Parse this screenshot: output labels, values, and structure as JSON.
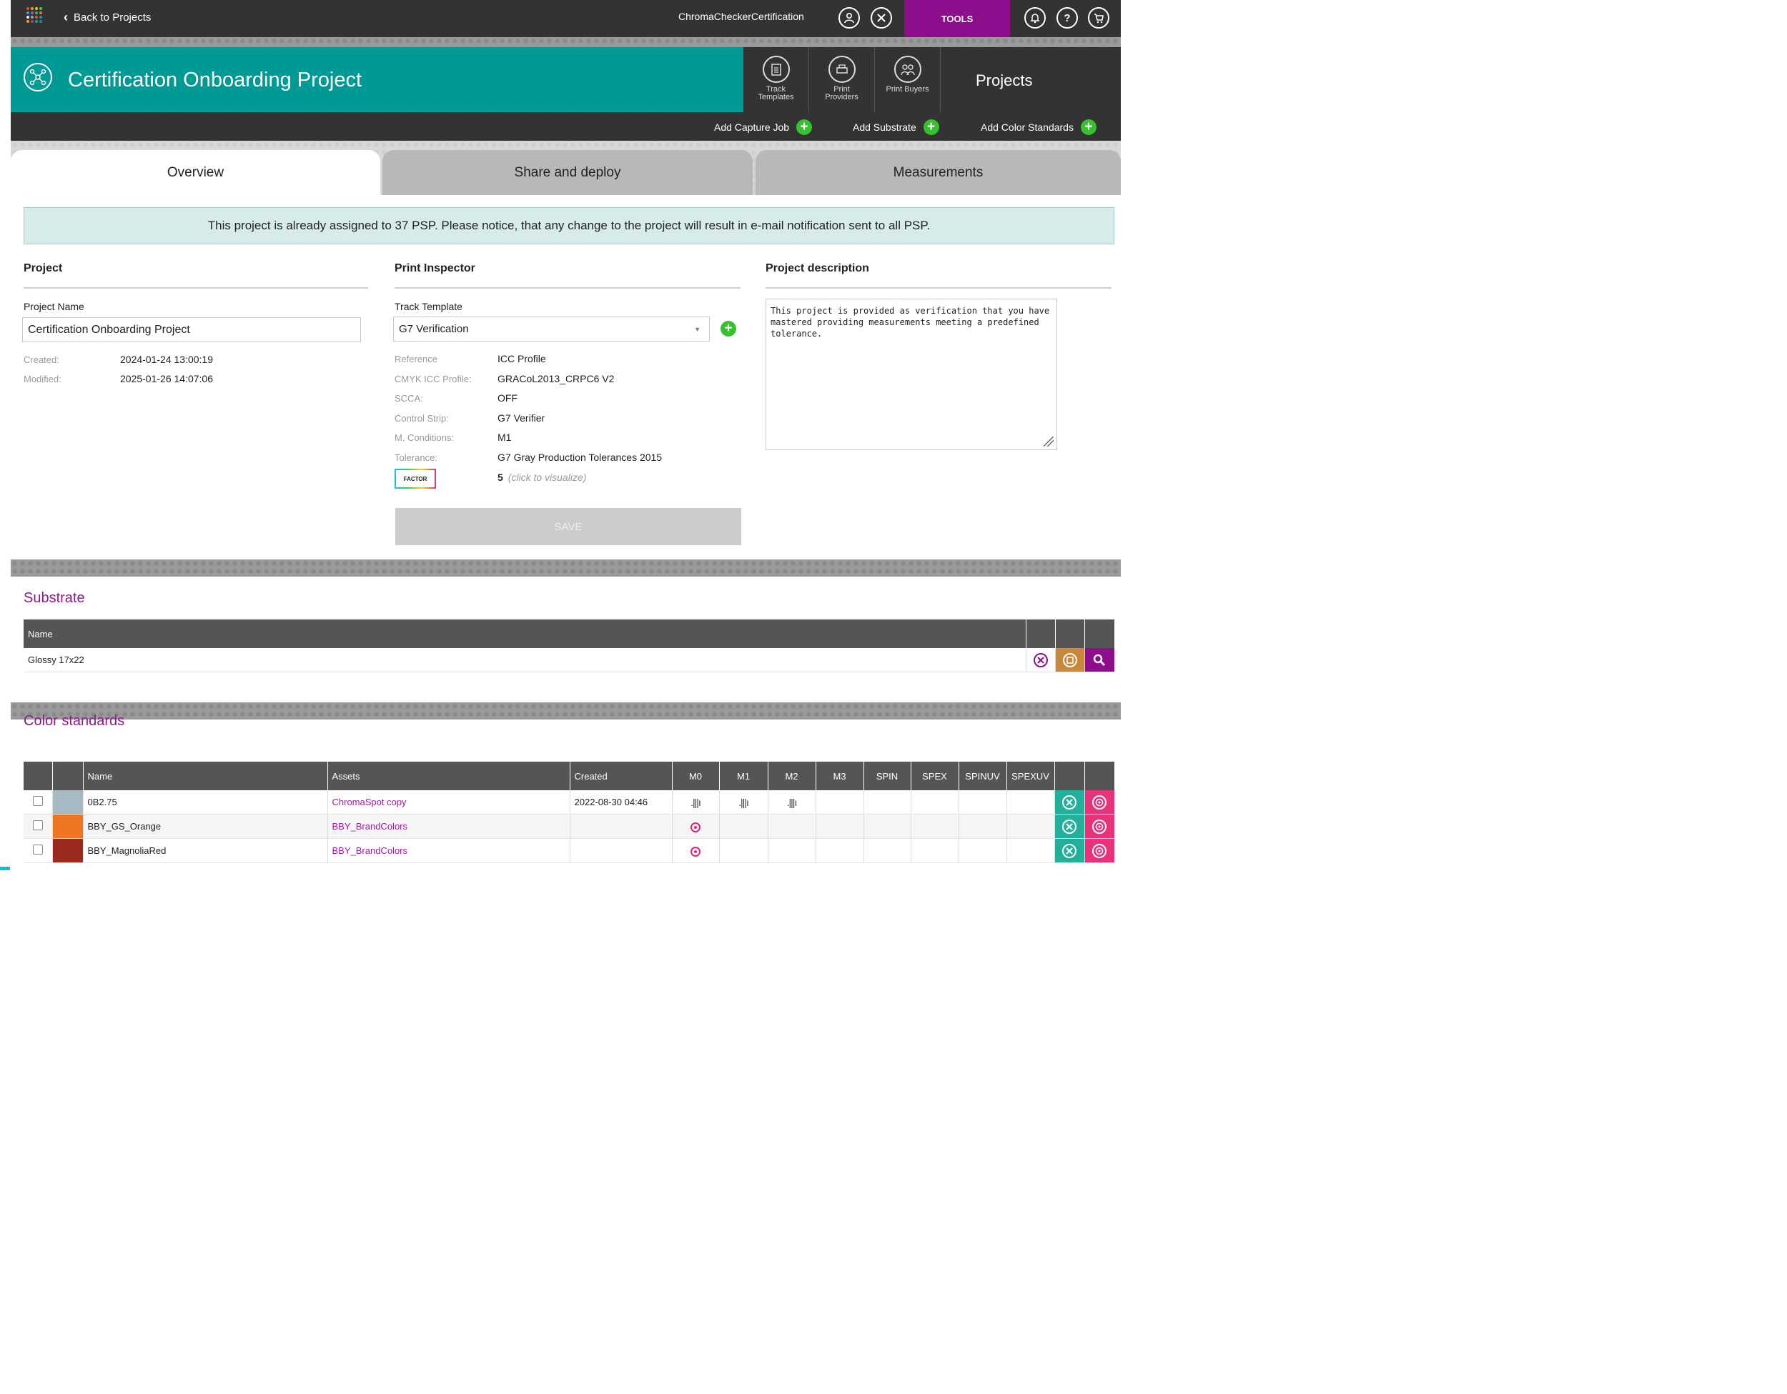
{
  "topbar": {
    "back_label": "Back to Projects",
    "account_name": "ChromaCheckerCertification",
    "tools_label": "TOOLS",
    "icons": [
      "apps-grid-icon",
      "user-icon",
      "tools-icon",
      "bell-icon",
      "help-icon",
      "cart-icon"
    ]
  },
  "header": {
    "title": "Certification Onboarding Project",
    "shortcuts": [
      {
        "label": "Track Templates",
        "icon": "clipboard-icon"
      },
      {
        "label": "Print Providers",
        "icon": "printer-icon"
      },
      {
        "label": "Print Buyers",
        "icon": "buyers-icon"
      }
    ],
    "section_label": "Projects"
  },
  "actions": {
    "add_capture_job": "Add Capture Job",
    "add_substrate": "Add Substrate",
    "add_color_standards": "Add Color Standards"
  },
  "tabs": [
    "Overview",
    "Share and deploy",
    "Measurements"
  ],
  "notice": "This project is already assigned to 37 PSP. Please notice, that any change to the project will result in e-mail notification sent to all PSP.",
  "project": {
    "section_title": "Project",
    "name_label": "Project Name",
    "name_value": "Certification Onboarding Project",
    "created_label": "Created:",
    "created_value": "2024-01-24 13:00:19",
    "modified_label": "Modified:",
    "modified_value": "2025-01-26 14:07:06"
  },
  "print_inspector": {
    "section_title": "Print Inspector",
    "track_template_label": "Track Template",
    "track_template_value": "G7 Verification",
    "rows": [
      {
        "label": "Reference",
        "value": "ICC Profile"
      },
      {
        "label": "CMYK ICC Profile:",
        "value": "GRACoL2013_CRPC6 V2"
      },
      {
        "label": "SCCA:",
        "value": "OFF"
      },
      {
        "label": "Control Strip:",
        "value": "G7 Verifier"
      },
      {
        "label": "M. Conditions:",
        "value": "M1"
      },
      {
        "label": "Tolerance:",
        "value": "G7 Gray Production Tolerances 2015"
      }
    ],
    "factor_badge": "FACTOR",
    "factor_value": "5",
    "factor_hint": "(click to visualize)",
    "save_label": "SAVE"
  },
  "description": {
    "section_title": "Project description",
    "text": "This project is provided as verification that you have mastered providing measurements meeting a predefined tolerance."
  },
  "substrate": {
    "title": "Substrate",
    "header_name": "Name",
    "rows": [
      {
        "name": "Glossy 17x22"
      }
    ]
  },
  "color_standards": {
    "title": "Color standards",
    "headers": [
      "Name",
      "Assets",
      "Created",
      "M0",
      "M1",
      "M2",
      "M3",
      "SPIN",
      "SPEX",
      "SPINUV",
      "SPEXUV"
    ],
    "rows": [
      {
        "swatch": "#a7b9c2",
        "name": "0B2.75",
        "assets": "ChromaSpot copy",
        "created": "2022-08-30 04:46"
      },
      {
        "swatch": "#ee7622",
        "name": "BBY_GS_Orange",
        "assets": "BBY_BrandColors",
        "created": ""
      },
      {
        "swatch": "#9b2a1e",
        "name": "BBY_MagnoliaRed",
        "assets": "BBY_BrandColors",
        "created": ""
      }
    ]
  },
  "colors": {
    "teal": "#009a96",
    "dark": "#333333",
    "purple": "#8d0d8d",
    "green": "#38c12e",
    "orange_btn": "#c8873a",
    "pink_btn": "#e8337a",
    "teal_btn": "#22b09a"
  }
}
